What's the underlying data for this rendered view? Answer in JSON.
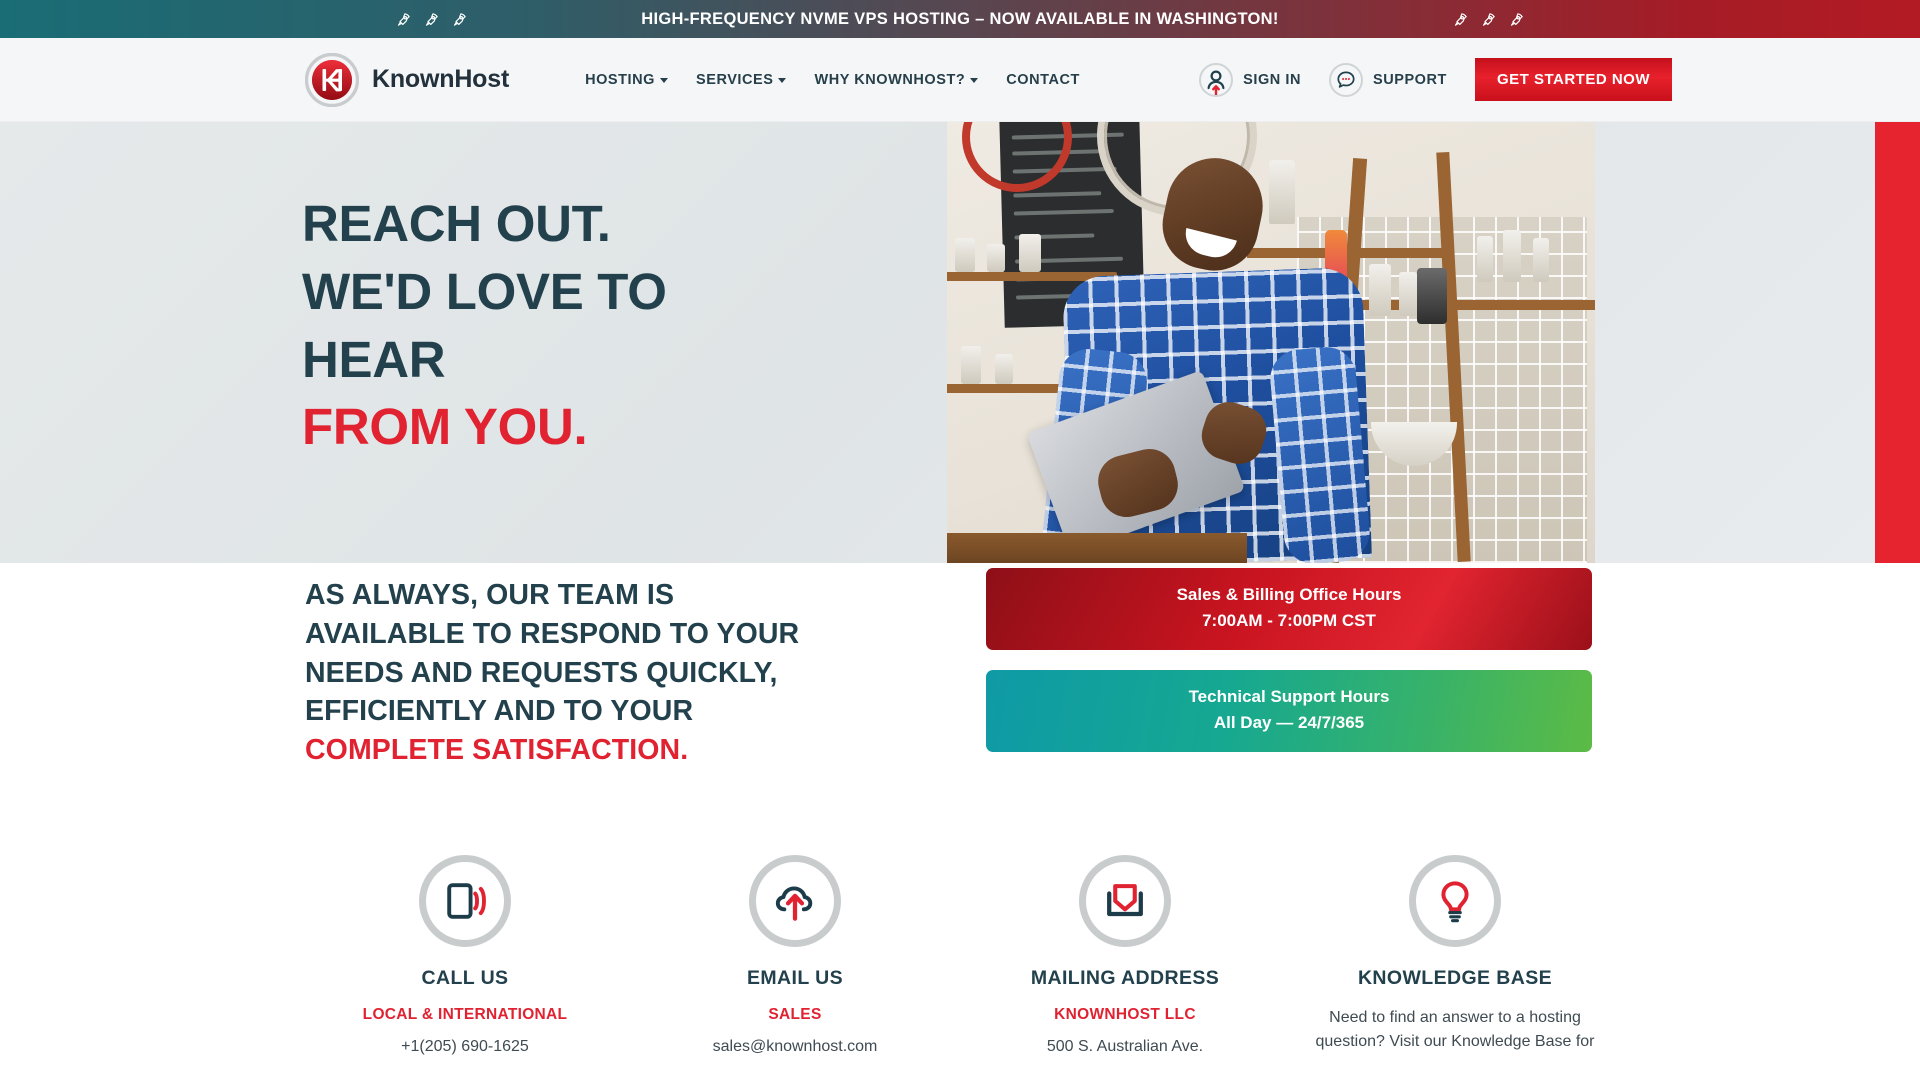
{
  "announcement": {
    "text": "HIGH-FREQUENCY NVME VPS HOSTING – NOW AVAILABLE IN WASHINGTON!",
    "icon_left": "rocket-icon",
    "icon_right": "rocket-icon",
    "rocket_count": 3,
    "gradient_from": "#1a6d75",
    "gradient_to": "#b31b24"
  },
  "nav": {
    "logo_text": "KnownHost",
    "logo_monogram": "KH",
    "menu": [
      {
        "label": "HOSTING",
        "has_dropdown": true
      },
      {
        "label": "SERVICES",
        "has_dropdown": true
      },
      {
        "label": "WHY KNOWNHOST?",
        "has_dropdown": true
      },
      {
        "label": "CONTACT",
        "has_dropdown": false
      }
    ],
    "sign_in_label": "SIGN IN",
    "sign_in_icon": "user-icon",
    "support_label": "SUPPORT",
    "support_icon": "chat-bubble-icon",
    "cta_label": "GET STARTED NOW",
    "cta_color": "#e8212c"
  },
  "hero": {
    "lines": [
      {
        "text": "REACH OUT.",
        "accent": false
      },
      {
        "text": "WE'D LOVE TO",
        "accent": false
      },
      {
        "text": "HEAR",
        "accent": false
      },
      {
        "text": "FROM YOU.",
        "accent": true
      }
    ],
    "heading_color": "#23414c",
    "accent_color": "#e02231",
    "image_alt": "Smiling man in blue plaid shirt holding a tablet in a cafe",
    "strip_color": "#e5242f"
  },
  "mid": {
    "lines": [
      {
        "text": "AS ALWAYS, OUR TEAM IS",
        "accent": false
      },
      {
        "text": "AVAILABLE TO RESPOND TO YOUR",
        "accent": false
      },
      {
        "text": "NEEDS AND REQUESTS QUICKLY,",
        "accent": false
      },
      {
        "text": "EFFICIENTLY AND TO YOUR",
        "accent": false
      },
      {
        "text": "COMPLETE SATISFACTION.",
        "accent": true
      }
    ],
    "cards": [
      {
        "title": "Sales & Billing Office Hours",
        "sub": "7:00AM - 7:00PM CST",
        "color": "#c81420"
      },
      {
        "title": "Technical Support Hours",
        "sub": "All Day — 24/7/365",
        "color": "#16a891"
      }
    ]
  },
  "contacts": [
    {
      "icon": "phone-signal-icon",
      "title": "CALL US",
      "sub": "LOCAL & INTERNATIONAL",
      "detail": "+1(205) 690-1625"
    },
    {
      "icon": "cloud-upload-icon",
      "title": "EMAIL US",
      "sub": "SALES",
      "detail": "sales@knownhost.com"
    },
    {
      "icon": "open-envelope-icon",
      "title": "MAILING ADDRESS",
      "sub": "KNOWNHOST LLC",
      "detail": "500 S. Australian Ave."
    },
    {
      "icon": "lightbulb-icon",
      "title": "KNOWLEDGE BASE",
      "sub": "",
      "detail": "Need to find an answer to a hosting question? Visit our Knowledge Base for"
    }
  ]
}
